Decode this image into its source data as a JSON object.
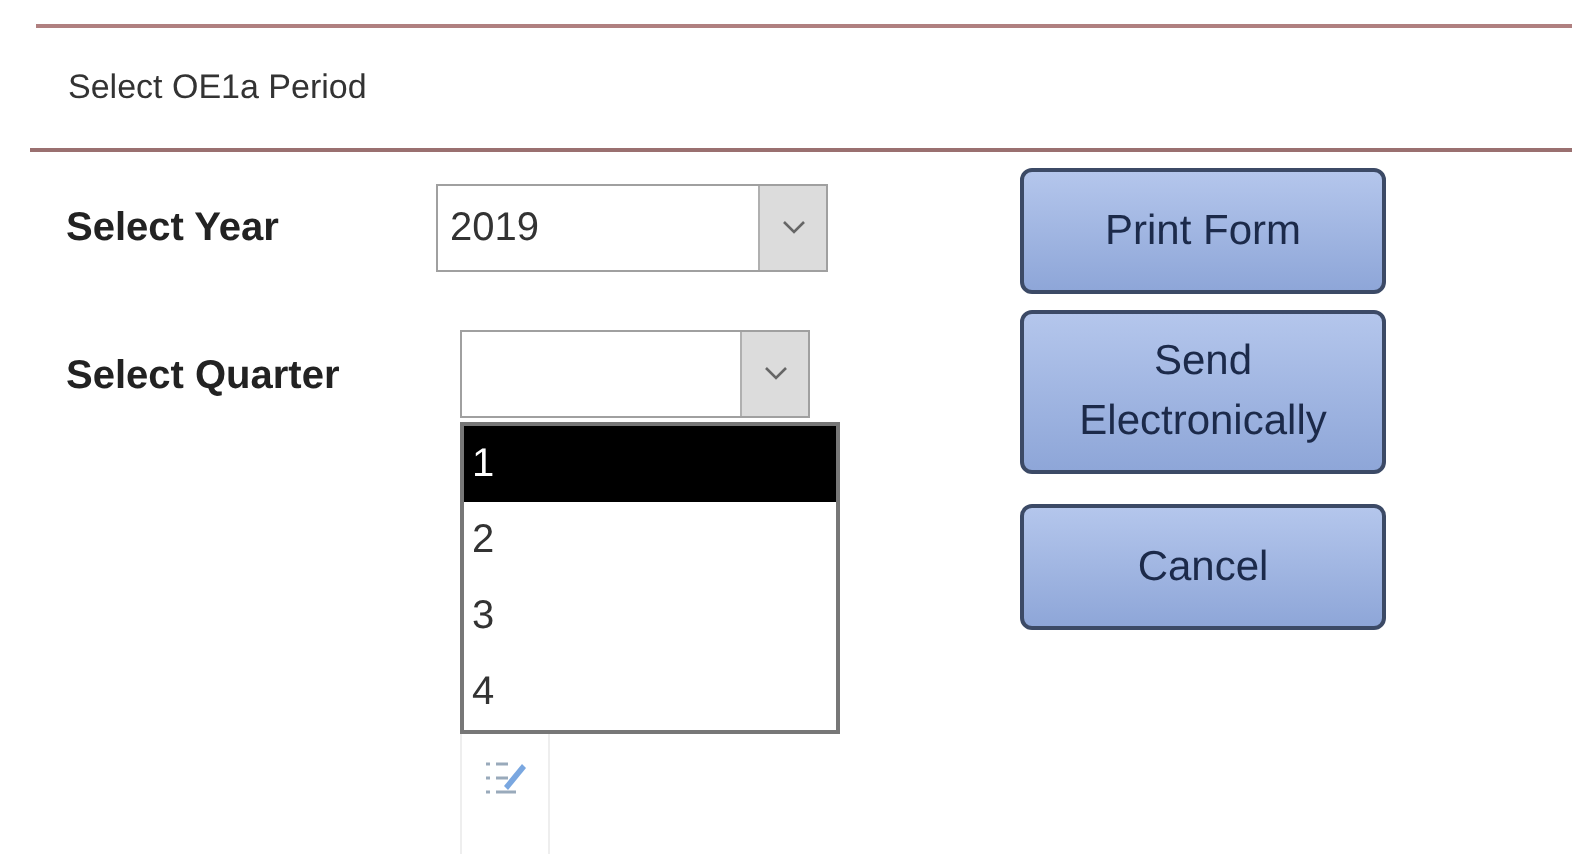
{
  "window": {
    "title": "Select OE1a Period"
  },
  "year": {
    "label": "Select Year",
    "value": "2019"
  },
  "quarter": {
    "label": "Select Quarter",
    "options": [
      {
        "label": "1",
        "selected": true
      },
      {
        "label": "2",
        "selected": false
      },
      {
        "label": "3",
        "selected": false
      },
      {
        "label": "4",
        "selected": false
      }
    ]
  },
  "buttons": [
    {
      "label": "Print Form"
    },
    {
      "label": "Send Electronically"
    },
    {
      "label": "Cancel"
    }
  ]
}
